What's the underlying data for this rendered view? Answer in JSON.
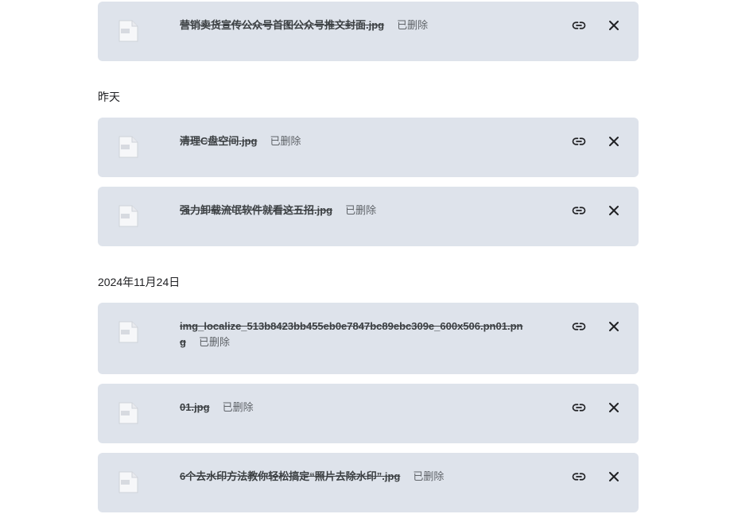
{
  "sections": [
    {
      "date": "",
      "items": [
        {
          "name": "营销卖货宣传公众号首图公众号推文封面.jpg",
          "status": "已删除"
        }
      ]
    },
    {
      "date": "昨天",
      "items": [
        {
          "name": "清理C盘空间.jpg",
          "status": "已删除"
        },
        {
          "name": "强力卸载流氓软件就看这五招.jpg",
          "status": "已删除"
        }
      ]
    },
    {
      "date": "2024年11月24日",
      "items": [
        {
          "name": "img_localize_513b8423bb455eb0e7847bc89ebc309e_600x506.pn01.png",
          "status": "已删除"
        },
        {
          "name": "01.jpg",
          "status": "已删除"
        },
        {
          "name": "6个去水印方法教你轻松搞定“照片去除水印”.jpg",
          "status": "已删除"
        }
      ]
    }
  ],
  "icons": {
    "file": "file-image-icon",
    "link": "link-icon",
    "remove": "close-icon"
  },
  "colors": {
    "card_bg": "#dee3eb",
    "status_text": "#5f6368"
  }
}
